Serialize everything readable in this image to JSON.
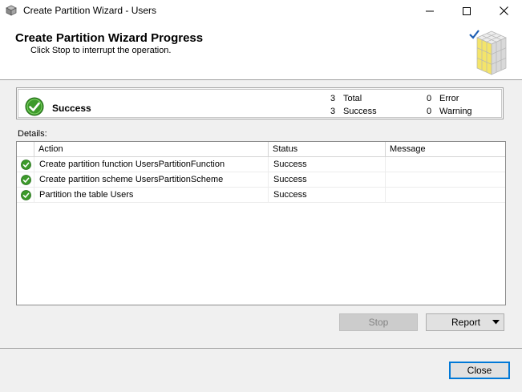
{
  "window": {
    "title": "Create Partition Wizard - Users"
  },
  "header": {
    "title": "Create Partition Wizard Progress",
    "subtitle": "Click Stop to interrupt the operation."
  },
  "summary": {
    "status": "Success",
    "total_count": "3",
    "total_label": "Total",
    "success_count": "3",
    "success_label": "Success",
    "error_count": "0",
    "error_label": "Error",
    "warning_count": "0",
    "warning_label": "Warning"
  },
  "details": {
    "label": "Details:",
    "columns": [
      "Action",
      "Status",
      "Message"
    ],
    "rows": [
      {
        "action": "Create partition function UsersPartitionFunction",
        "status": "Success",
        "message": ""
      },
      {
        "action": "Create partition scheme UsersPartitionScheme",
        "status": "Success",
        "message": ""
      },
      {
        "action": "Partition the table Users",
        "status": "Success",
        "message": ""
      }
    ]
  },
  "buttons": {
    "stop": "Stop",
    "report": "Report",
    "close": "Close"
  },
  "icons": {
    "status": "success-check-icon",
    "window": "wizard-app-icon"
  },
  "colors": {
    "success_green": "#3c9a2a",
    "accent": "#0078d7"
  }
}
